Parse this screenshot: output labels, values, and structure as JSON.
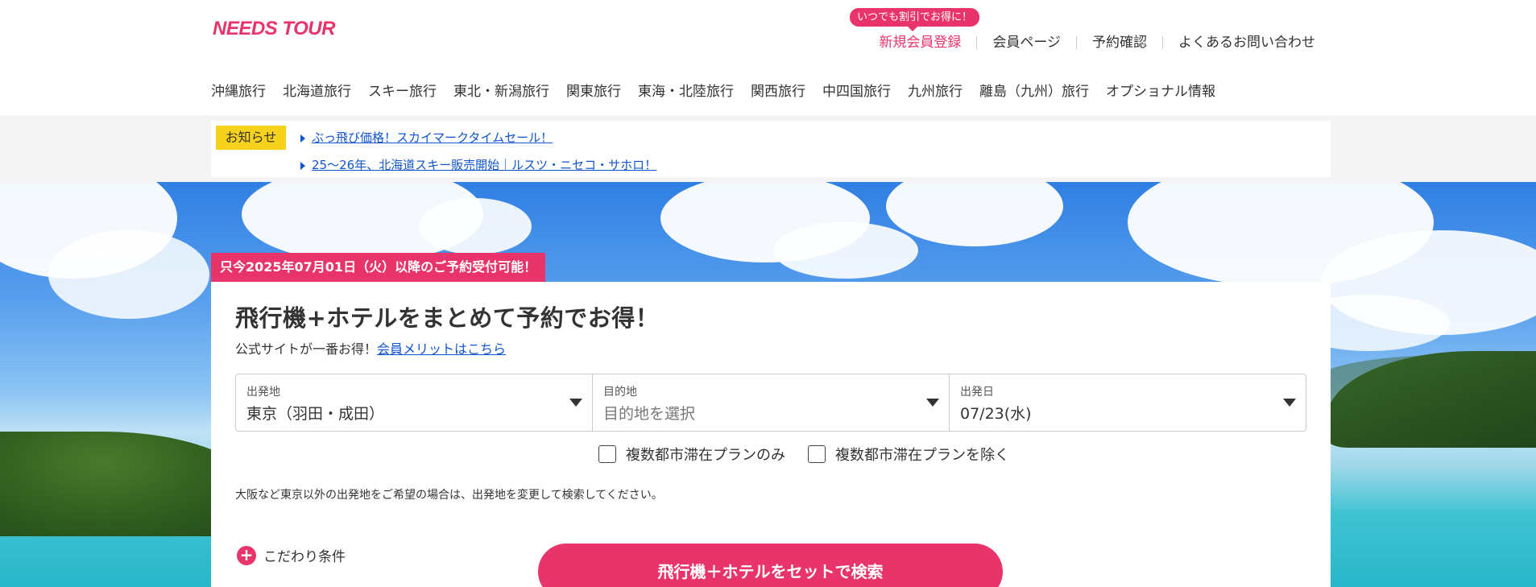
{
  "header": {
    "logo": "NEEDS TOUR",
    "promo_bubble": "いつでも割引でお得に！",
    "util_nav": [
      {
        "label": "新規会員登録"
      },
      {
        "label": "会員ページ"
      },
      {
        "label": "予約確認"
      },
      {
        "label": "よくあるお問い合わせ"
      }
    ],
    "main_nav": [
      {
        "label": "沖縄旅行"
      },
      {
        "label": "北海道旅行"
      },
      {
        "label": "スキー旅行"
      },
      {
        "label": "東北・新潟旅行"
      },
      {
        "label": "関東旅行"
      },
      {
        "label": "東海・北陸旅行"
      },
      {
        "label": "関西旅行"
      },
      {
        "label": "中四国旅行"
      },
      {
        "label": "九州旅行"
      },
      {
        "label": "離島（九州）旅行"
      },
      {
        "label": "オプショナル情報"
      }
    ]
  },
  "notice": {
    "label": "お知らせ",
    "links": [
      {
        "text": "ぶっ飛び価格！スカイマークタイムセール！"
      },
      {
        "text": "25〜26年、北海道スキー販売開始｜ルスツ・ニセコ・サホロ！"
      }
    ]
  },
  "search": {
    "availability_badge": "只今2025年07月01日（火）以降のご予約受付可能！",
    "title": "飛行機+ホテルをまとめて予約でお得！",
    "subtitle_text": "公式サイトが一番お得！",
    "subtitle_link": "会員メリットはこちら",
    "fields": [
      {
        "label": "出発地",
        "value": "東京（羽田・成田）",
        "placeholder": false
      },
      {
        "label": "目的地",
        "value": "目的地を選択",
        "placeholder": true
      },
      {
        "label": "出発日",
        "value": "07/23(水)",
        "placeholder": false
      }
    ],
    "checkboxes": [
      {
        "label": "複数都市滞在プランのみ",
        "checked": false
      },
      {
        "label": "複数都市滞在プランを除く",
        "checked": false
      }
    ],
    "note": "大阪など東京以外の出発地をご希望の場合は、出発地を変更して検索してください。",
    "conditions_label": "こだわり条件",
    "search_button": "飛行機＋ホテルをセットで検索"
  },
  "colors": {
    "accent": "#e8336b",
    "notice_label": "#f7d21c",
    "link": "#1155cc"
  }
}
